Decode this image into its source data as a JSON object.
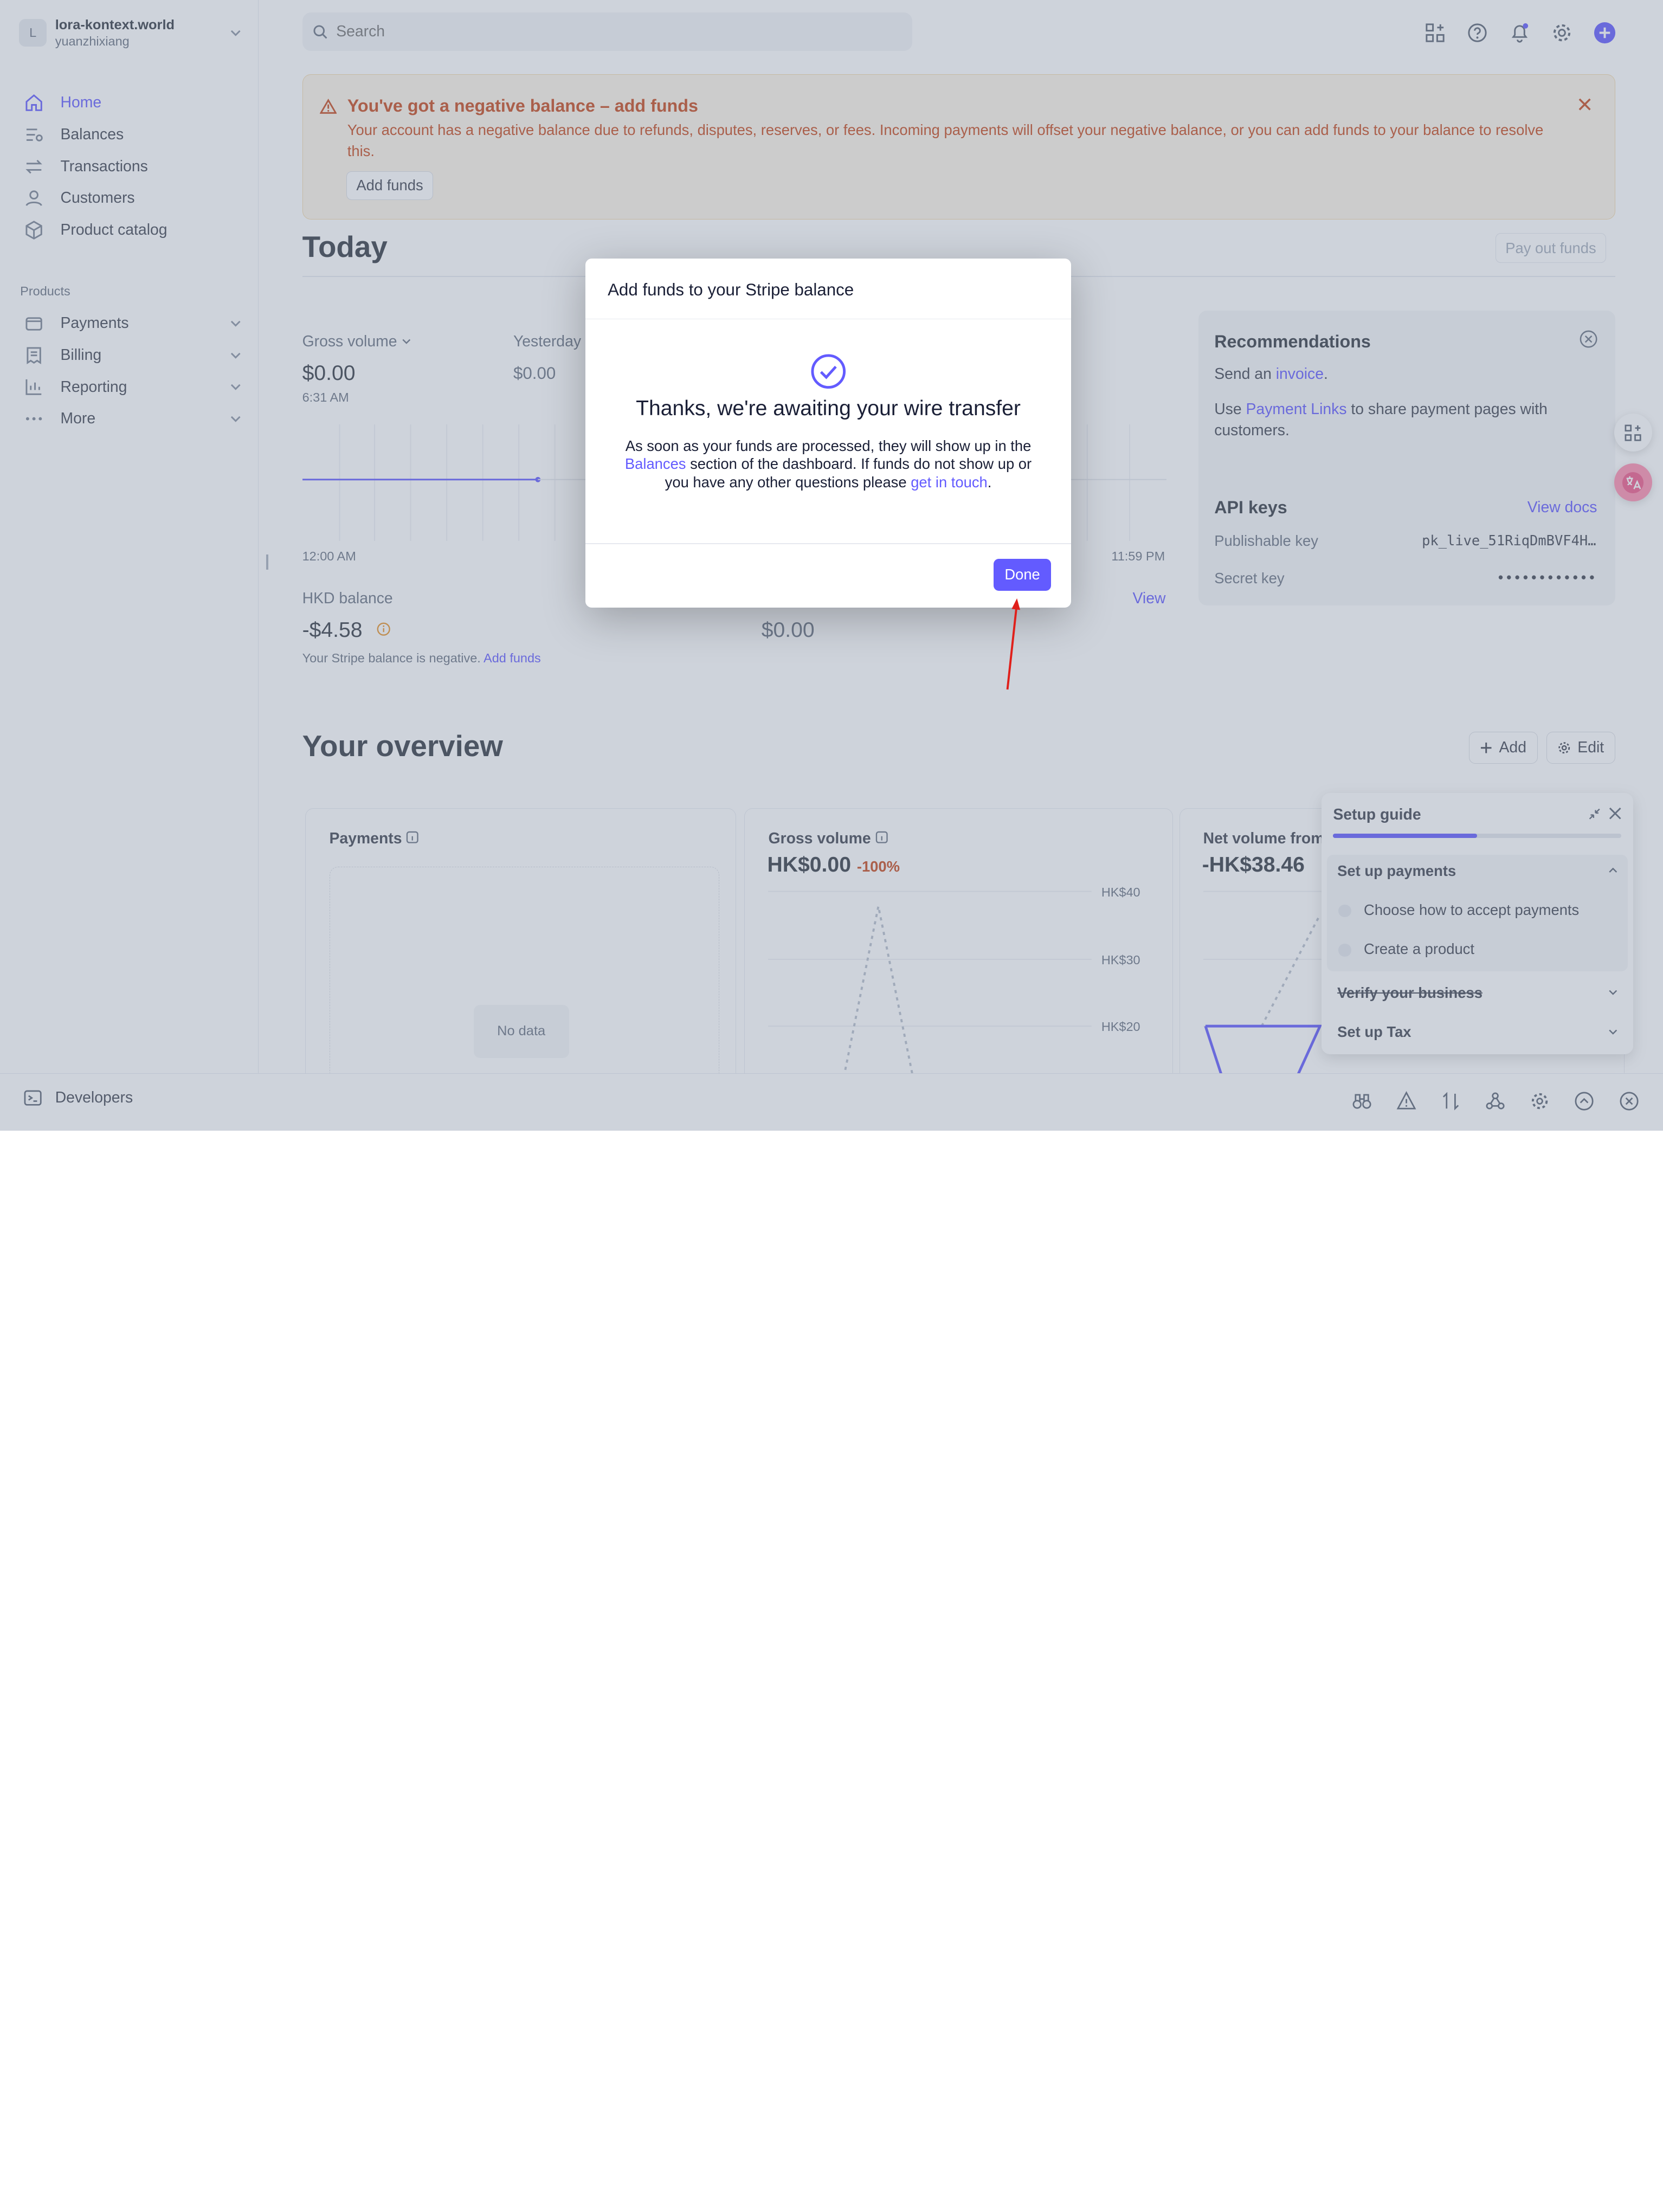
{
  "account": {
    "badge": "L",
    "name": "lora-kontext.world",
    "user": "yuanzhixiang"
  },
  "sidebar": {
    "items": [
      {
        "label": "Home",
        "icon": "home-icon",
        "active": true
      },
      {
        "label": "Balances",
        "icon": "balances-icon"
      },
      {
        "label": "Transactions",
        "icon": "transactions-icon"
      },
      {
        "label": "Customers",
        "icon": "customers-icon"
      },
      {
        "label": "Product catalog",
        "icon": "product-catalog-icon"
      }
    ],
    "section_label": "Products",
    "products": [
      {
        "label": "Payments",
        "icon": "payments-icon"
      },
      {
        "label": "Billing",
        "icon": "billing-icon"
      },
      {
        "label": "Reporting",
        "icon": "reporting-icon"
      },
      {
        "label": "More",
        "icon": "more-icon"
      }
    ]
  },
  "search": {
    "placeholder": "Search"
  },
  "banner": {
    "title": "You've got a negative balance – add funds",
    "body": "Your account has a negative balance due to refunds, disputes, reserves, or fees. Incoming payments will offset your negative balance, or you can add funds to your balance to resolve this.",
    "button": "Add funds"
  },
  "today": {
    "title": "Today",
    "payout_button": "Pay out funds",
    "gross_label": "Gross volume",
    "gross_value": "$0.00",
    "gross_time": "6:31 AM",
    "yesterday_label": "Yesterday",
    "yesterday_value": "$0.00",
    "axis_start": "12:00 AM",
    "axis_end": "11:59 PM",
    "hkd_label": "HKD balance",
    "hkd_value": "-$4.58",
    "hkd_note": "Your Stripe balance is negative.",
    "hkd_link": "Add funds",
    "payouts_value": "$0.00",
    "view_link": "View"
  },
  "recommendations": {
    "title": "Recommendations",
    "line1_pre": "Send an ",
    "line1_link": "invoice",
    "line1_post": ".",
    "line2_pre": "Use ",
    "line2_link": "Payment Links",
    "line2_post": " to share payment pages with customers.",
    "api_title": "API keys",
    "api_link": "View docs",
    "pub_label": "Publishable key",
    "pub_value": "pk_live_51RiqDmBVF4H…",
    "secret_label": "Secret key",
    "secret_value": "••••••••••••"
  },
  "overview": {
    "title": "Your overview",
    "add_button": "Add",
    "edit_button": "Edit",
    "payments_title": "Payments",
    "no_data": "No data",
    "gross_title": "Gross volume",
    "gross_value": "HK$0.00",
    "gross_change": "-100%",
    "net_title": "Net volume from",
    "net_value": "-HK$38.46",
    "y_ticks": [
      "HK$40",
      "HK$30",
      "HK$20"
    ]
  },
  "setup_guide": {
    "title": "Setup guide",
    "progress": 0.5,
    "sections": [
      {
        "label": "Set up payments",
        "expanded": true,
        "items": [
          "Choose how to accept payments",
          "Create a product"
        ]
      },
      {
        "label": "Verify your business",
        "done": true
      },
      {
        "label": "Set up Tax"
      }
    ]
  },
  "devbar": {
    "label": "Developers"
  },
  "modal": {
    "header": "Add funds to your Stripe balance",
    "title": "Thanks, we're awaiting your wire transfer",
    "body_1": "As soon as your funds are processed, they will show up in the ",
    "body_link1": "Balances",
    "body_2": " section of the dashboard. If funds do not show up or you have any other questions please ",
    "body_link2": "get in touch",
    "body_3": ".",
    "done_button": "Done"
  },
  "colors": {
    "accent": "#635bff",
    "warning": "#c74a1e",
    "annotation_arrow": "#e0201b"
  }
}
